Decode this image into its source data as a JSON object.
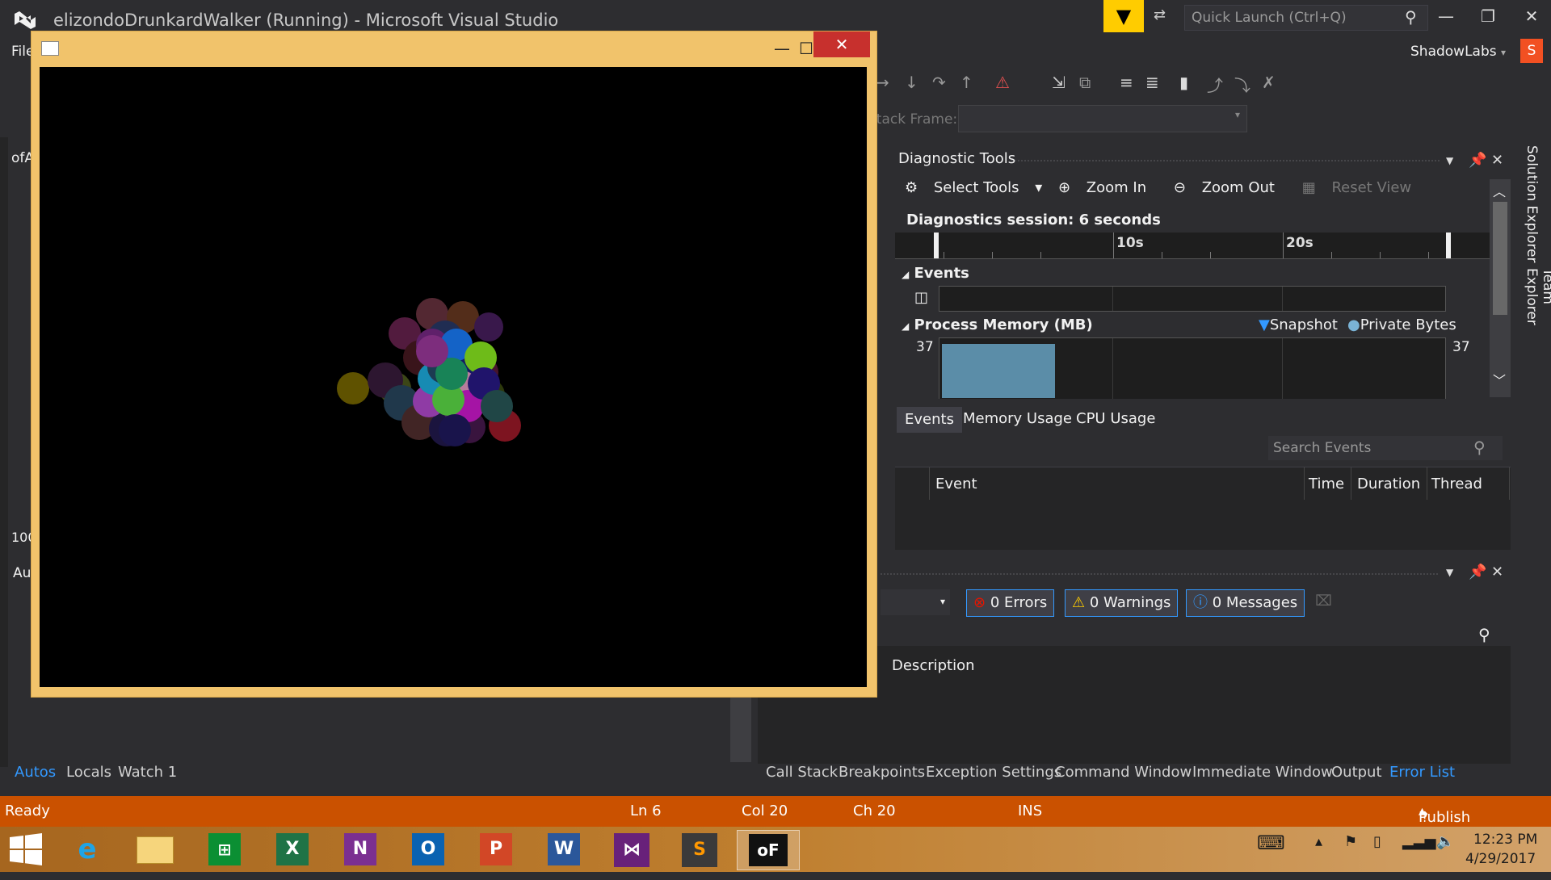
{
  "window": {
    "title": "elizondoDrunkardWalker (Running) - Microsoft Visual Studio",
    "quick_launch_placeholder": "Quick Launch (Ctrl+Q)",
    "user": "ShadowLabs",
    "avatar_letter": "S",
    "menu_file": "File"
  },
  "debug": {
    "stack_frame_label": "Stack Frame:"
  },
  "diagnostics": {
    "title": "Diagnostic Tools",
    "select_tools": "Select Tools",
    "zoom_in": "Zoom In",
    "zoom_out": "Zoom Out",
    "reset_view": "Reset View",
    "session": "Diagnostics session: 6 seconds",
    "ruler_labels": [
      "10s",
      "20s"
    ],
    "events_section": "Events",
    "memory_section": "Process Memory (MB)",
    "legend_snapshot": "Snapshot",
    "legend_private_bytes": "Private Bytes",
    "mem_left": "37",
    "mem_right": "37",
    "tabs": [
      "Events",
      "Memory Usage",
      "CPU Usage"
    ],
    "search_placeholder": "Search Events",
    "columns": [
      "Event",
      "Time",
      "Duration",
      "Thread"
    ]
  },
  "error_list": {
    "errors": "0 Errors",
    "warnings": "0 Warnings",
    "messages": "0 Messages",
    "description_col": "Description"
  },
  "left_tabs": [
    "Autos",
    "Locals",
    "Watch 1"
  ],
  "right_tabs": [
    "Call Stack",
    "Breakpoints",
    "Exception Settings",
    "Command Window",
    "Immediate Window",
    "Output",
    "Error List"
  ],
  "left_fragments": {
    "ofa": "ofA",
    "zoom": "100",
    "au": "Au"
  },
  "side_tabs": [
    "Solution Explorer",
    "Team Explorer"
  ],
  "status": {
    "text": "Ready",
    "ln": "Ln 6",
    "col": "Col 20",
    "ch": "Ch 20",
    "ins": "INS",
    "publish": "Publish"
  },
  "taskbar": {
    "time": "12:23 PM",
    "date": "4/29/2017"
  },
  "colors": {
    "vs_bg": "#2d2d30",
    "status_bar": "#ca5100",
    "accent": "#3399ff",
    "app_frame": "#f1c36b",
    "close_red": "#c7302d"
  }
}
